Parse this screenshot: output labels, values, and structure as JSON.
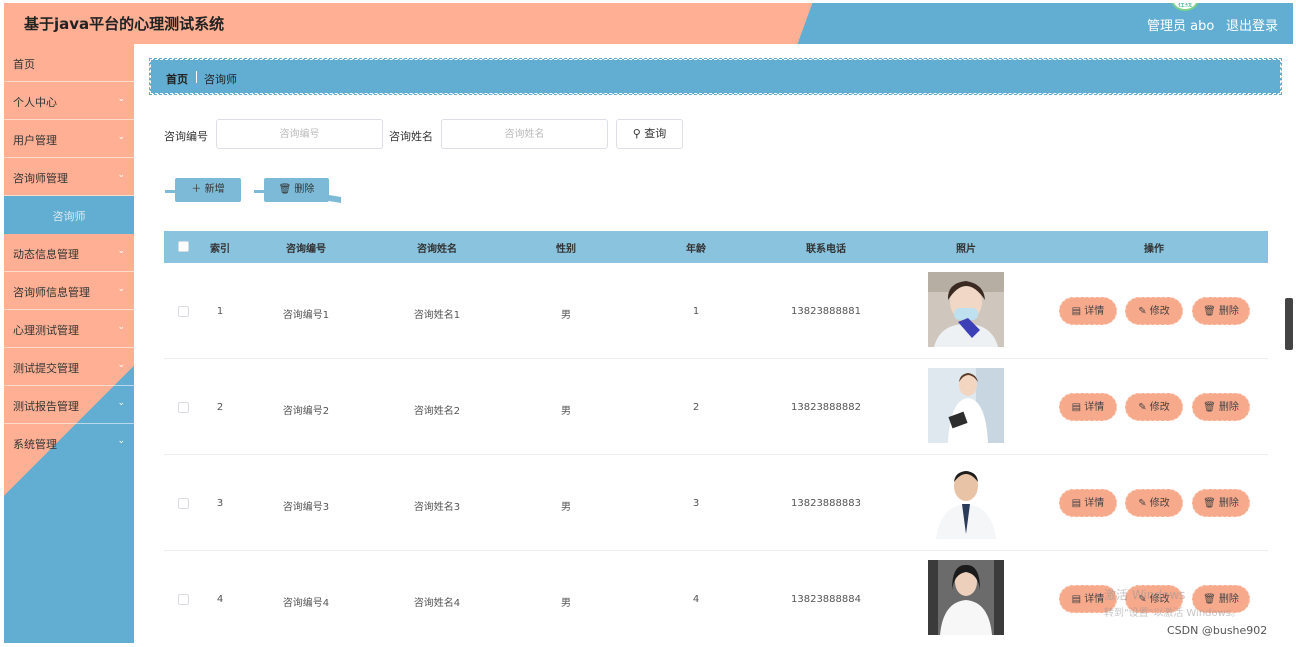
{
  "app": {
    "title": "基于java平台的心理测试系统",
    "user": "管理员 abo",
    "logout": "退出登录",
    "badge": "在线"
  },
  "sidebar": {
    "items": [
      {
        "label": "首页",
        "chevron": ""
      },
      {
        "label": "个人中心",
        "chevron": "⌄"
      },
      {
        "label": "用户管理",
        "chevron": "⌄"
      },
      {
        "label": "咨询师管理",
        "chevron": "⌄"
      },
      {
        "label": "咨询师",
        "chevron": ""
      },
      {
        "label": "动态信息管理",
        "chevron": "⌄"
      },
      {
        "label": "咨询师信息管理",
        "chevron": "⌄"
      },
      {
        "label": "心理测试管理",
        "chevron": "⌄"
      },
      {
        "label": "测试提交管理",
        "chevron": "⌄"
      },
      {
        "label": "测试报告管理",
        "chevron": "⌄"
      },
      {
        "label": "系统管理",
        "chevron": "⌄"
      }
    ]
  },
  "breadcrumb": {
    "home": "首页",
    "current": "咨询师"
  },
  "search": {
    "label1": "咨询编号",
    "placeholder1": "咨询编号",
    "label2": "咨询姓名",
    "placeholder2": "咨询姓名",
    "query": "查询",
    "query_icon": "search-icon"
  },
  "actions": {
    "add": "＋ 新增",
    "delete": "🗑 删除"
  },
  "table": {
    "columns": [
      "索引",
      "咨询编号",
      "咨询姓名",
      "性别",
      "年龄",
      "联系电话",
      "照片",
      "操作"
    ],
    "rows": [
      {
        "index": "1",
        "code": "咨询编号1",
        "name": "咨询姓名1",
        "gender": "男",
        "age": "1",
        "phone": "13823888881"
      },
      {
        "index": "2",
        "code": "咨询编号2",
        "name": "咨询姓名2",
        "gender": "男",
        "age": "2",
        "phone": "13823888882"
      },
      {
        "index": "3",
        "code": "咨询编号3",
        "name": "咨询姓名3",
        "gender": "男",
        "age": "3",
        "phone": "13823888883"
      },
      {
        "index": "4",
        "code": "咨询编号4",
        "name": "咨询姓名4",
        "gender": "男",
        "age": "4",
        "phone": "13823888884"
      }
    ],
    "op_detail": "▤ 详情",
    "op_edit": "✎ 修改",
    "op_delete": "🗑 删除"
  },
  "watermark": {
    "line1": "激活 Windows",
    "line2": "转到\"设置\"以激活 Windows。"
  },
  "csdn": "CSDN @bushe902",
  "colors": {
    "salmon": "#ffb094",
    "blue": "#62aed2",
    "header_row": "#89c3de",
    "op_button": "#f7a98c"
  }
}
